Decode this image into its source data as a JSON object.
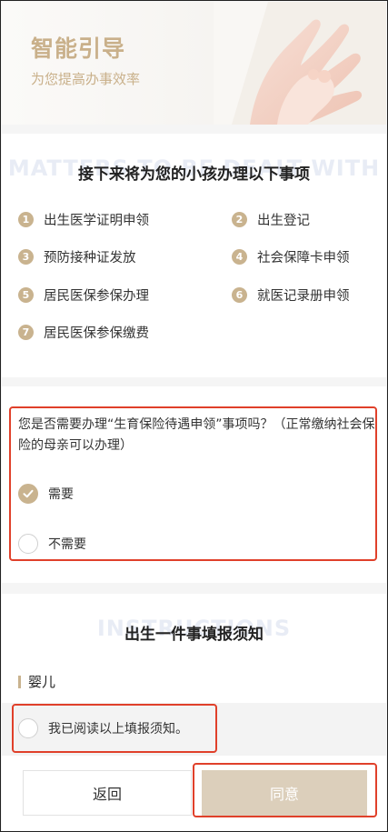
{
  "hero": {
    "title": "智能引导",
    "subtitle": "为您提高办事效率"
  },
  "matters": {
    "watermark": "MATTERS TO BE DEALT WITH",
    "title": "接下来将为您的小孩办理以下事项",
    "items": [
      {
        "num": "1",
        "label": "出生医学证明申领"
      },
      {
        "num": "2",
        "label": "出生登记"
      },
      {
        "num": "3",
        "label": "预防接种证发放"
      },
      {
        "num": "4",
        "label": "社会保障卡申领"
      },
      {
        "num": "5",
        "label": "居民医保参保办理"
      },
      {
        "num": "6",
        "label": "就医记录册申领"
      },
      {
        "num": "7",
        "label": "居民医保参保缴费"
      }
    ]
  },
  "question": {
    "text": "您是否需要办理“生育保险待遇申领”事项吗？（正常缴纳社会保险的母亲可以办理）",
    "options": [
      {
        "label": "需要",
        "checked": true
      },
      {
        "label": "不需要",
        "checked": false
      }
    ]
  },
  "instructions": {
    "watermark": "INSTRUCTIONS",
    "title": "出生一件事填报须知",
    "baby_label": "婴儿"
  },
  "confirm": {
    "label": "我已阅读以上填报须知。"
  },
  "buttons": {
    "back": "返回",
    "agree": "同意"
  },
  "colors": {
    "accent": "#c9b38f",
    "highlight": "#e0402a",
    "agree_bg": "#dccfbb"
  }
}
